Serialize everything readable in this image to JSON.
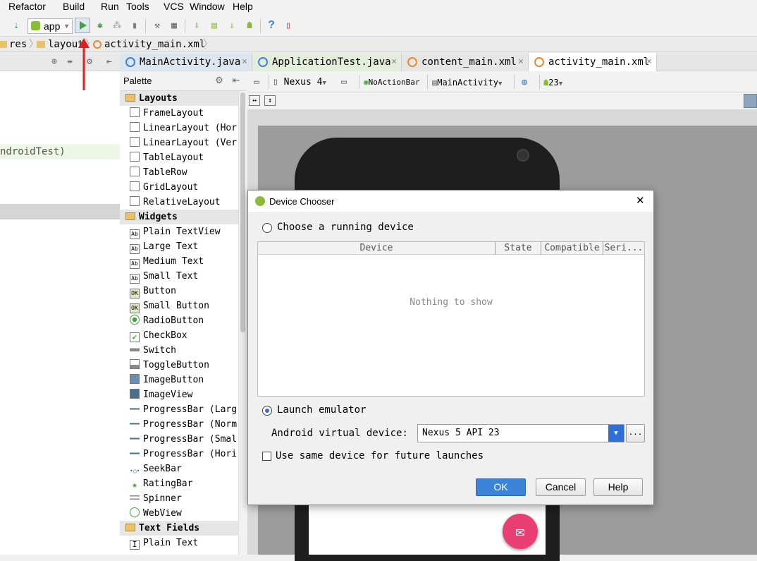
{
  "menubar": {
    "items": [
      "Refactor",
      "Build",
      "Run",
      "Tools",
      "VCS",
      "Window",
      "Help"
    ],
    "underline": [
      "R",
      "B",
      "u",
      "T",
      "V",
      "W",
      "H"
    ]
  },
  "toolbar": {
    "run_config": "app",
    "run_icon": "play-icon",
    "help_glyph": "?"
  },
  "breadcrumbs": [
    "res",
    "layout",
    "activity_main.xml"
  ],
  "tabs": [
    {
      "label": "MainActivity.java",
      "close": "×"
    },
    {
      "label": "ApplicationTest.java",
      "close": "×"
    },
    {
      "label": "content_main.xml",
      "close": "×"
    },
    {
      "label": "activity_main.xml",
      "close": "×"
    }
  ],
  "left_panel": {
    "visible_text": "ndroidTest)"
  },
  "palette": {
    "title": "Palette",
    "categories": [
      {
        "name": "Layouts",
        "items": [
          "FrameLayout",
          "LinearLayout (Hor",
          "LinearLayout (Ver",
          "TableLayout",
          "TableRow",
          "GridLayout",
          "RelativeLayout"
        ]
      },
      {
        "name": "Widgets",
        "items": [
          "Plain TextView",
          "Large Text",
          "Medium Text",
          "Small Text",
          "Button",
          "Small Button",
          "RadioButton",
          "CheckBox",
          "Switch",
          "ToggleButton",
          "ImageButton",
          "ImageView",
          "ProgressBar (Larg",
          "ProgressBar (Norm",
          "ProgressBar (Smal",
          "ProgressBar (Hori",
          "SeekBar",
          "RatingBar",
          "Spinner",
          "WebView"
        ]
      },
      {
        "name": "Text Fields",
        "items": [
          "Plain Text"
        ]
      }
    ]
  },
  "designer_toolbar": {
    "device": "Nexus 4",
    "theme": "NoActionBar",
    "activity": "MainActivity",
    "api": "23"
  },
  "dialog": {
    "title": "Device Chooser",
    "close_glyph": "✕",
    "running_label": "Choose a running device",
    "running_underline": "C",
    "columns": [
      "Device",
      "State",
      "Compatible",
      "Seri..."
    ],
    "empty_text": "Nothing to show",
    "launch_label": "Launch emulator",
    "launch_underline": "L",
    "avd_label": "Android virtual device:",
    "avd_value": "Nexus 5 API 23",
    "avd_more": "...",
    "same_device_label": "Use same device for future launches",
    "ok": "OK",
    "cancel": "Cancel",
    "help": "Help",
    "running_selected": false,
    "launch_selected": true,
    "same_device_checked": false
  },
  "colors": {
    "accent": "#3b84d7",
    "fab": "#ea3f74",
    "arrow": "#e02020",
    "run_green": "#3fa33f"
  }
}
